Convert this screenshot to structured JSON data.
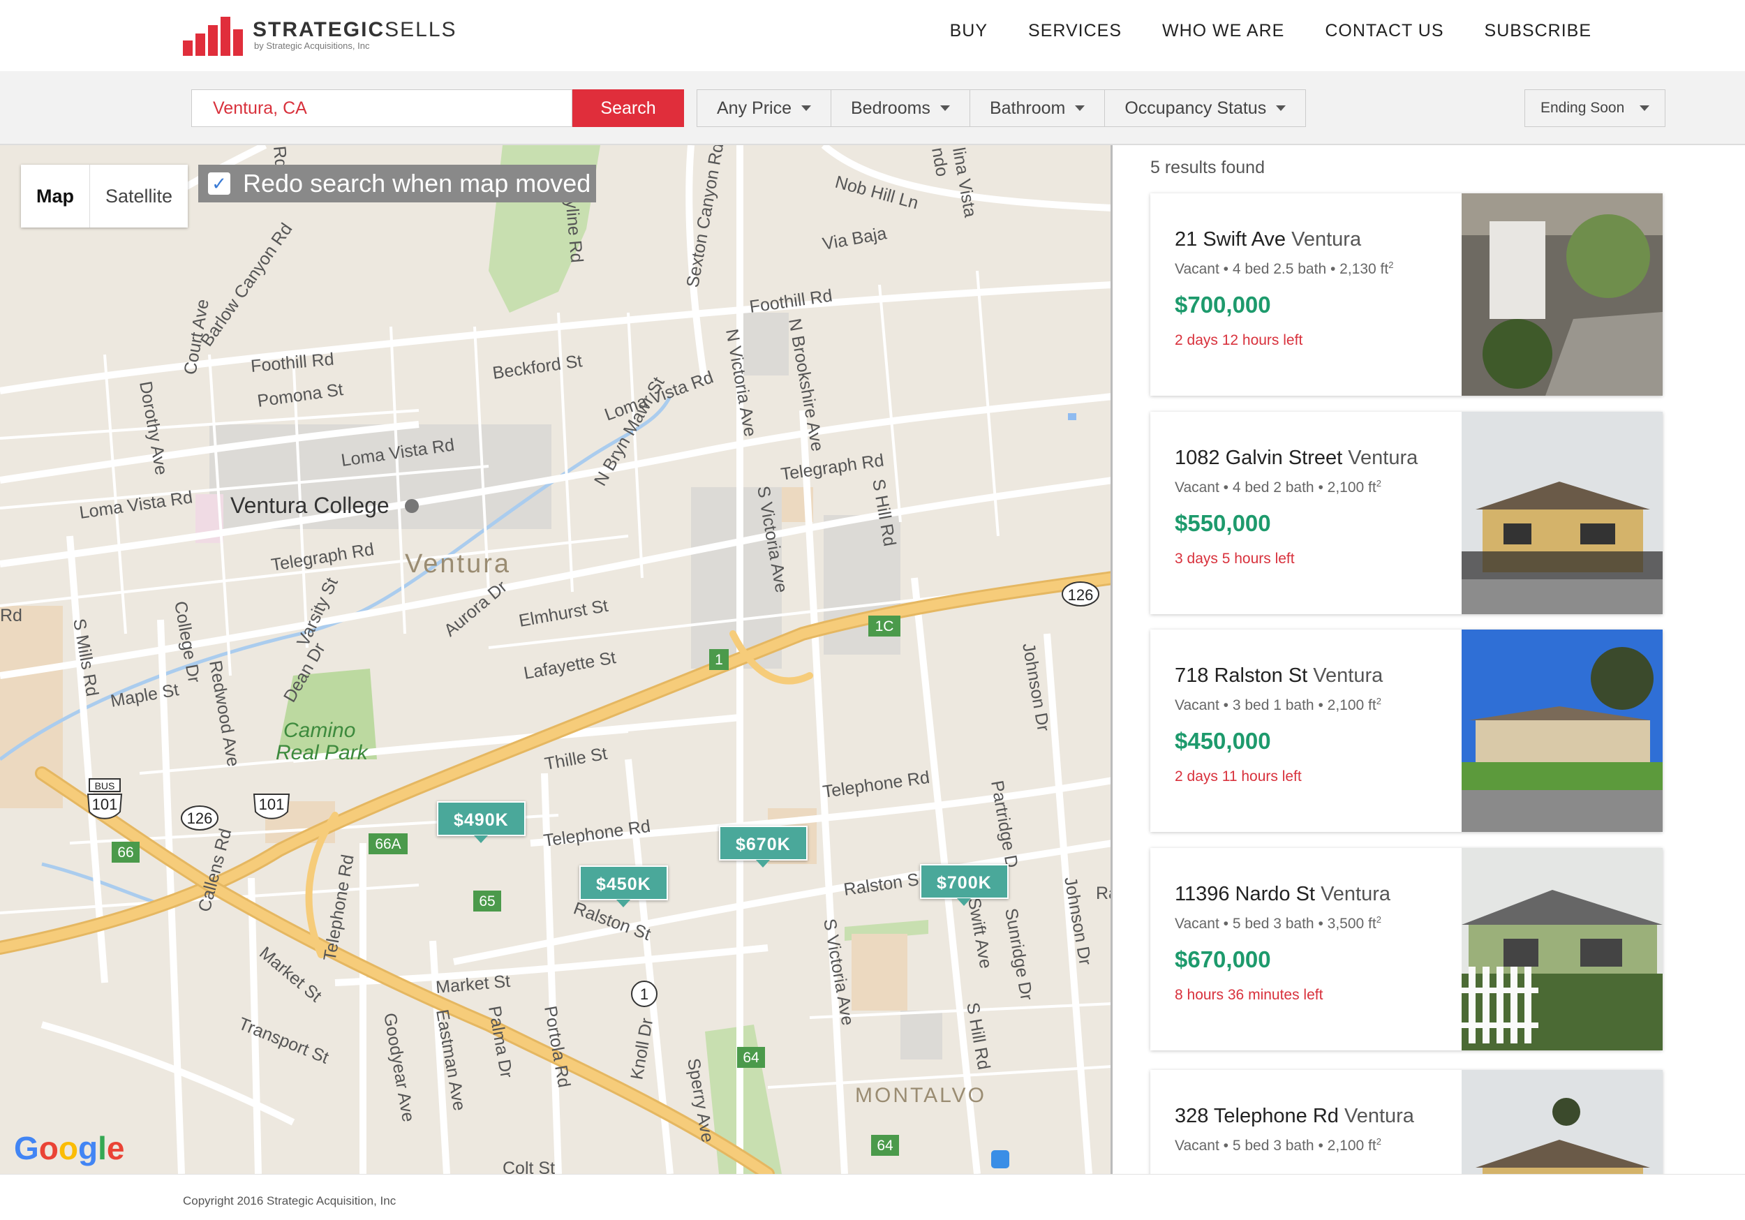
{
  "brand": {
    "name_bold": "STRATEGIC",
    "name_light": "SELLS",
    "tagline": "by Strategic Acquisitions, Inc",
    "accent_color": "#e02e3b"
  },
  "nav": {
    "items": [
      {
        "label": "BUY"
      },
      {
        "label": "SERVICES"
      },
      {
        "label": "WHO WE ARE"
      },
      {
        "label": "CONTACT US"
      },
      {
        "label": "SUBSCRIBE"
      }
    ]
  },
  "search": {
    "value": "Ventura, CA",
    "button_label": "Search"
  },
  "filters": {
    "price": "Any Price",
    "bedrooms": "Bedrooms",
    "bathroom": "Bathroom",
    "occupancy": "Occupancy Status"
  },
  "sort": {
    "selected": "Ending Soon"
  },
  "map": {
    "toggle_map": "Map",
    "toggle_satellite": "Satellite",
    "redo_checked": true,
    "redo_label": "Redo search when map moved",
    "check_glyph": "✓",
    "provider": "Google",
    "pins": [
      {
        "label": "$490K"
      },
      {
        "label": "$670K"
      },
      {
        "label": "$450K"
      },
      {
        "label": "$700K"
      }
    ],
    "labels": {
      "college": "Ventura College",
      "city": "Ventura",
      "park1": "Camino",
      "park2": "Real Park",
      "montalvo": "MONTALVO",
      "foothill1": "Foothill Rd",
      "foothill2": "Foothill Rd",
      "telegraph1": "Telegraph Rd",
      "telegraph2": "Telegraph Rd",
      "lomavista1": "Loma Vista Rd",
      "lomavista2": "Loma Vista Rd",
      "lomavista3": "Loma Vista Rd",
      "telephone1": "Telephone Rd",
      "telephone2": "Telephone Rd",
      "telephone3": "Telephone Rd",
      "ralston1": "Ralston St",
      "ralston2": "Ralston S",
      "market": "Market St",
      "lafayette": "Lafayette St",
      "elmhurst": "Elmhurst St",
      "thille": "Thille St",
      "beckford": "Beckford St",
      "pomona": "Pomona St",
      "maple": "Maple St",
      "nobhill": "Nob Hill Ln",
      "viabaja": "Via Baja",
      "barlow": "Barlow Canyon Rd",
      "sexton": "Sexton Canyon Rd",
      "skyline": "Skyline Rd",
      "nvictoria": "N Victoria Ave",
      "svictoria1": "S Victoria Ave",
      "svictoria2": "S Victoria Ave",
      "nbrookshire": "N Brookshire Ave",
      "shill1": "S Hill Rd",
      "shill2": "S Hill Rd",
      "johnson1": "Johnson Dr",
      "johnson2": "Johnson Dr",
      "nbrynmawr": "N Bryn Mawr St",
      "varsity": "Varsity St",
      "aurora": "Aurora Dr",
      "dean": "Dean Dr",
      "smills": "S Mills Rd",
      "college_dr": "College Dr",
      "redwood": "Redwood Ave",
      "dorothy": "Dorothy Ave",
      "court": "Court Ave",
      "callens": "Callens Rd",
      "markets": "Market St",
      "transport": "Transport St",
      "goodyear": "Goodyear Ave",
      "eastman": "Eastman Ave",
      "palma": "Palma Dr",
      "portola": "Portola Rd",
      "knoll": "Knoll Dr",
      "sperry": "Sperry Ave",
      "partridge": "Partridge D",
      "sunridge": "Sunridge Dr",
      "swift": "Swift Ave",
      "colt": "Colt St",
      "linavista": "lina Vista",
      "ndo": "ndo",
      "rd_left": "Rd",
      "ra_right": "Ra",
      "rd_top": "Rd"
    },
    "shields": {
      "hwy126a": "126",
      "hwy126b": "126",
      "us101": "101",
      "us101b": "101",
      "bus": "BUS",
      "hwy1a": "1",
      "exit1": "1",
      "exit1c": "1C",
      "exit66": "66",
      "exit66a": "66A",
      "exit65": "65",
      "exit64a": "64",
      "exit64b": "64"
    }
  },
  "results": {
    "count_text": "5 results found",
    "listings": [
      {
        "street": "21 Swift Ave",
        "city": "Ventura",
        "meta": "Vacant • 4 bed 2.5 bath • 2,130 ft",
        "sup": "2",
        "price": "$700,000",
        "time_left": "2 days 12 hours left"
      },
      {
        "street": "1082 Galvin Street",
        "city": "Ventura",
        "meta": "Vacant • 4 bed 2 bath • 2,100 ft",
        "sup": "2",
        "price": "$550,000",
        "time_left": "3 days 5 hours left"
      },
      {
        "street": "718 Ralston St",
        "city": "Ventura",
        "meta": "Vacant • 3 bed 1 bath • 2,100 ft",
        "sup": "2",
        "price": "$450,000",
        "time_left": "2 days 11 hours left"
      },
      {
        "street": "11396 Nardo St",
        "city": "Ventura",
        "meta": "Vacant • 5 bed 3 bath • 3,500 ft",
        "sup": "2",
        "price": "$670,000",
        "time_left": "8 hours 36 minutes left"
      },
      {
        "street": "328 Telephone Rd",
        "city": "Ventura",
        "meta": "Vacant • 5 bed 3 bath • 2,100 ft",
        "sup": "2",
        "price": "",
        "time_left": ""
      }
    ]
  },
  "footer": {
    "copyright": "Copyright 2016 Strategic Acquisition, Inc"
  }
}
